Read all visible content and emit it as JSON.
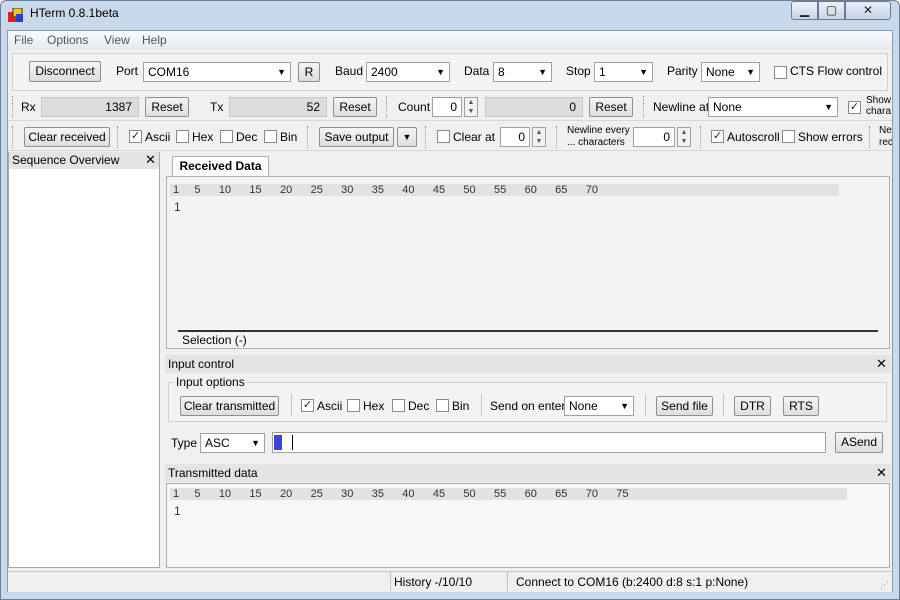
{
  "window": {
    "title": "HTerm 0.8.1beta",
    "min": "▁",
    "max": "▢",
    "close": "✕"
  },
  "menu": [
    "File",
    "Options",
    "View",
    "Help"
  ],
  "connection": {
    "disconnect": "Disconnect",
    "port_label": "Port",
    "port_value": "COM16",
    "refresh": "R",
    "baud_label": "Baud",
    "baud_value": "2400",
    "data_label": "Data",
    "data_value": "8",
    "stop_label": "Stop",
    "stop_value": "1",
    "parity_label": "Parity",
    "parity_value": "None",
    "cts_label": "CTS Flow control"
  },
  "counters": {
    "rx_label": "Rx",
    "rx_value": "1387",
    "rx_reset": "Reset",
    "tx_label": "Tx",
    "tx_value": "52",
    "tx_reset": "Reset",
    "count_label": "Count",
    "count_value": "0",
    "count_field": "0",
    "count_reset": "Reset",
    "newline_label": "Newline at",
    "newline_value": "None",
    "show_chars_1": "Show",
    "show_chars_2": "chara"
  },
  "display": {
    "clear_received": "Clear received",
    "ascii": "Ascii",
    "hex": "Hex",
    "dec": "Dec",
    "bin": "Bin",
    "save_output": "Save output",
    "clear_at": "Clear at",
    "clear_at_value": "0",
    "newline_every_1": "Newline every",
    "newline_every_2": "... characters",
    "newline_every_value": "0",
    "autoscroll": "Autoscroll",
    "show_errors": "Show errors",
    "ne_1": "Ne",
    "ne_2": "rec"
  },
  "sequence": {
    "title": "Sequence Overview"
  },
  "received": {
    "tab": "Received Data",
    "ruler": "1     5      10      15      20      25      30      35      40      45      50      55      60      65      70",
    "line1": "1",
    "selection": "Selection (-)"
  },
  "input_control": {
    "title": "Input control",
    "options_title": "Input options",
    "clear_transmitted": "Clear transmitted",
    "ascii": "Ascii",
    "hex": "Hex",
    "dec": "Dec",
    "bin": "Bin",
    "send_on_enter_label": "Send on enter",
    "send_on_enter_value": "None",
    "send_file": "Send file",
    "dtr": "DTR",
    "rts": "RTS",
    "type_label": "Type",
    "type_value": "ASC",
    "asend": "ASend"
  },
  "transmitted": {
    "title": "Transmitted data",
    "ruler": "1     5      10      15      20      25      30      35      40      45      50      55      60      65      70      75",
    "line1": "1"
  },
  "status": {
    "history": "History -/10/10",
    "connection": "Connect to COM16 (b:2400 d:8 s:1 p:None)"
  },
  "colors": {
    "accent": "#3a46d6",
    "frame": "#c9d9ec"
  }
}
